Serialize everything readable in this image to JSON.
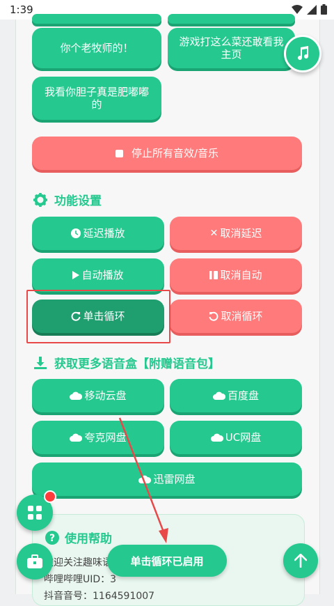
{
  "status_bar": {
    "time": "1:39"
  },
  "sound_buttons": [
    {
      "label": "你个老牧师的！"
    },
    {
      "label": "游戏打这么菜还敢看我主页"
    },
    {
      "label": "我看你胆子真是肥嘟嘟的"
    }
  ],
  "stop_all": {
    "label": "停止所有音效/音乐"
  },
  "settings": {
    "title": "功能设置",
    "delay_play": "延迟播放",
    "cancel_delay": "取消延迟",
    "auto_play": "自动播放",
    "cancel_auto": "取消自动",
    "single_loop": "单击循环",
    "cancel_loop": "取消循环"
  },
  "download": {
    "title": "获取更多语音盒【附赠语音包】",
    "mobile_cloud": "移动云盘",
    "baidu": "百度盘",
    "quark": "夸克网盘",
    "uc": "UC网盘",
    "xunlei": "迅雷网盘"
  },
  "help": {
    "title": "使用帮助",
    "line1": "欢迎关注趣味语",
    "line2": "哔哩哔哩UID：3",
    "line3": "抖音音号：1164591007"
  },
  "toast": {
    "text": "单击循环已启用"
  },
  "colors": {
    "primary": "#25c98f",
    "danger": "#ff7a7a",
    "highlight": "#e84848"
  }
}
